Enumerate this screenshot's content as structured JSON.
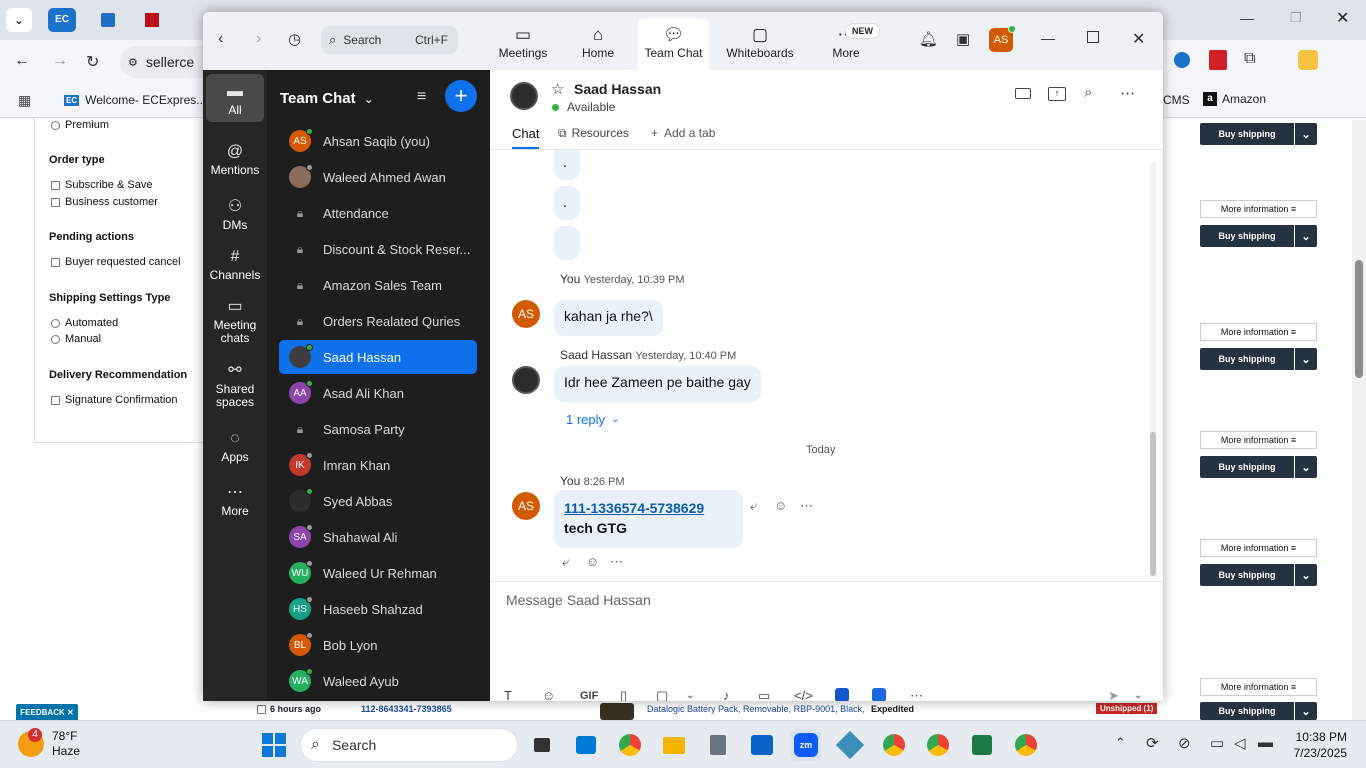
{
  "browser": {
    "url_fragment": "sellerce",
    "bookmarks": [
      {
        "label": "Welcome- ECExpres..."
      },
      {
        "label": "CMS"
      },
      {
        "label": "Amazon"
      }
    ]
  },
  "seller_page": {
    "top_option": "Premium",
    "sections": [
      {
        "title": "Order type",
        "options": [
          "Subscribe & Save",
          "Business customer"
        ]
      },
      {
        "title": "Pending actions",
        "options": [
          "Buyer requested cancel"
        ]
      },
      {
        "title": "Shipping Settings Type",
        "options": [
          "Automated",
          "Manual"
        ]
      },
      {
        "title": "Delivery Recommendation",
        "options": [
          "Signature Confirmation"
        ]
      }
    ],
    "buy_shipping_label": "Buy shipping",
    "more_info_label": "More information",
    "bottom_row": {
      "age": "6 hours ago",
      "order_id": "112-8643341-7393865",
      "product": "Datalogic Battery Pack, Removable, RBP-9001, Black,",
      "shipping": "Expedited",
      "status": "Unshipped (1)"
    },
    "feedback_label": "FEEDBACK"
  },
  "zoom": {
    "search_label": "Search",
    "search_shortcut": "Ctrl+F",
    "nav_tabs": [
      {
        "label": "Meetings",
        "icon": "video-icon"
      },
      {
        "label": "Home",
        "icon": "home-icon"
      },
      {
        "label": "Team Chat",
        "icon": "chat-icon"
      },
      {
        "label": "Whiteboards",
        "icon": "whiteboard-icon"
      },
      {
        "label": "More",
        "icon": "more-icon"
      }
    ],
    "new_badge": "NEW",
    "profile_initials": "AS",
    "rail": [
      {
        "label": "All",
        "icon": "chat-bubble-icon"
      },
      {
        "label": "Mentions",
        "icon": "at-icon"
      },
      {
        "label": "DMs",
        "icon": "people-icon"
      },
      {
        "label": "Channels",
        "icon": "hash-icon"
      },
      {
        "label": "Meeting chats",
        "icon": "calendar-icon"
      },
      {
        "label": "Shared spaces",
        "icon": "shared-spaces-icon"
      },
      {
        "label": "Apps",
        "icon": "apps-icon"
      },
      {
        "label": "More",
        "icon": "more-dots-icon"
      }
    ],
    "list_title": "Team Chat",
    "contacts": [
      {
        "name": "Ahsan Saqib (you)",
        "initials": "AS",
        "color": "#d35a00",
        "type": "avatar",
        "status": "#2fb344"
      },
      {
        "name": "Waleed Ahmed Awan",
        "initials": "",
        "color": "#8a6d5a",
        "type": "photo",
        "status": "#9a9a9a"
      },
      {
        "name": "Attendance",
        "type": "channel"
      },
      {
        "name": "Discount & Stock Reser...",
        "type": "channel"
      },
      {
        "name": "Amazon Sales Team",
        "type": "channel"
      },
      {
        "name": "Orders Realated Quries",
        "type": "channel"
      },
      {
        "name": "Saad Hassan",
        "initials": "",
        "color": "#3d3d3d",
        "type": "photo",
        "status": "#2fb344",
        "selected": true
      },
      {
        "name": "Asad Ali Khan",
        "initials": "AA",
        "color": "#8e44ad",
        "type": "avatar",
        "status": "#2fb344"
      },
      {
        "name": "Samosa Party",
        "type": "channel"
      },
      {
        "name": "Imran Khan",
        "initials": "IK",
        "color": "#c0392b",
        "type": "avatar",
        "status": "#9a9a9a"
      },
      {
        "name": "Syed Abbas",
        "initials": "",
        "color": "#2c2c2c",
        "type": "photo",
        "status": "#2fb344"
      },
      {
        "name": "Shahawal Ali",
        "initials": "SA",
        "color": "#8e44ad",
        "type": "avatar",
        "status": "#9a9a9a"
      },
      {
        "name": "Waleed Ur Rehman",
        "initials": "WU",
        "color": "#27ae60",
        "type": "avatar",
        "status": "#9a9a9a"
      },
      {
        "name": "Haseeb Shahzad",
        "initials": "HS",
        "color": "#16a085",
        "type": "avatar",
        "status": "#9a9a9a"
      },
      {
        "name": "Bob Lyon",
        "initials": "BL",
        "color": "#d35a00",
        "type": "avatar",
        "status": "#9a9a9a"
      },
      {
        "name": "Waleed Ayub",
        "initials": "WA",
        "color": "#27ae60",
        "type": "avatar",
        "status": "#2fb344"
      }
    ],
    "chat": {
      "name": "Saad Hassan",
      "status": "Available",
      "tabs": [
        "Chat",
        "Resources",
        "Add a tab"
      ],
      "messages": [
        {
          "sender": "You",
          "time": "Yesterday, 10:39 PM",
          "text": "kahan ja rhe?\\",
          "initials": "AS"
        },
        {
          "sender": "Saad Hassan",
          "time": "Yesterday, 10:40 PM",
          "text": "Idr hee Zameen pe baithe gay",
          "reply_label": "1 reply"
        },
        {
          "sender": "You",
          "time": "8:26 PM",
          "link": "111-1336574-5738629",
          "text": "tech GTG",
          "initials": "AS"
        }
      ],
      "dot_messages": [
        ".",
        ".",
        ""
      ],
      "date_divider": "Today",
      "composer_placeholder": "Message Saad Hassan",
      "gif_label": "GIF"
    }
  },
  "taskbar": {
    "weather_temp": "78°F",
    "weather_desc": "Haze",
    "weather_badge": "4",
    "search_label": "Search",
    "time": "10:38 PM",
    "date": "7/23/2025"
  }
}
